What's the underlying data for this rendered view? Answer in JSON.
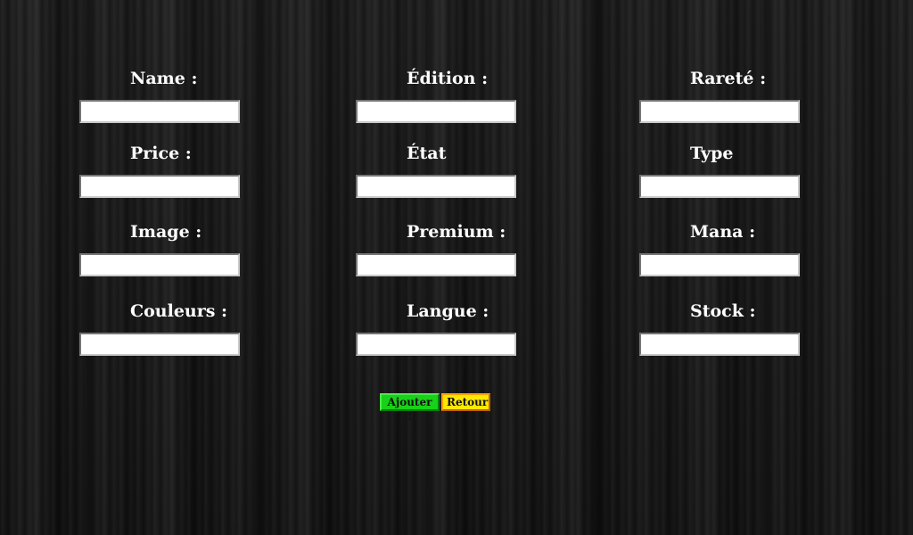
{
  "fields": [
    {
      "label": "Name :",
      "value": ""
    },
    {
      "label": "Édition :",
      "value": ""
    },
    {
      "label": "Rareté :",
      "value": ""
    },
    {
      "label": "Price :",
      "value": ""
    },
    {
      "label": "État",
      "value": ""
    },
    {
      "label": "Type",
      "value": ""
    },
    {
      "label": "Image :",
      "value": ""
    },
    {
      "label": "Premium :",
      "value": ""
    },
    {
      "label": "Mana :",
      "value": ""
    },
    {
      "label": "Couleurs :",
      "value": ""
    },
    {
      "label": "Langue :",
      "value": ""
    },
    {
      "label": "Stock :",
      "value": ""
    }
  ],
  "buttons": {
    "add_label": "Ajouter !",
    "back_label": "Retour"
  },
  "colors": {
    "add_button": "#19d119",
    "back_button": "#ffe800"
  }
}
